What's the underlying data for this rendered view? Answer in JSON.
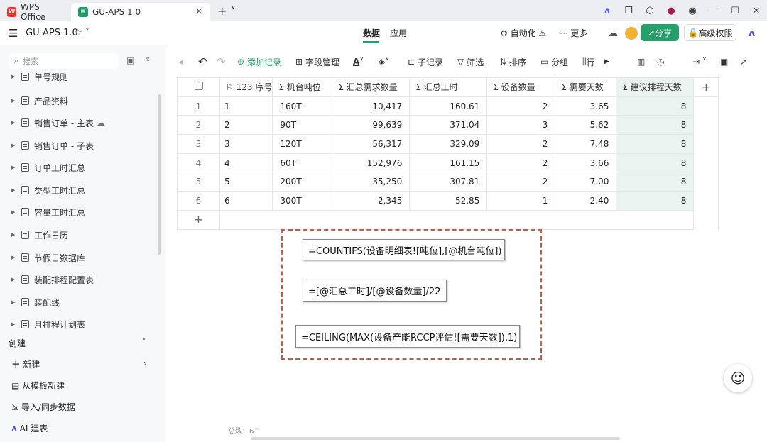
{
  "tabs": [
    {
      "label": "WPS Office"
    },
    {
      "label": "GU-APS 1.0"
    }
  ],
  "app": {
    "title": "GU-APS 1.0",
    "nav": [
      "数据",
      "应用"
    ],
    "automation": "自动化",
    "more": "更多",
    "share": "分享",
    "advanced": "高级权限"
  },
  "sidebar": {
    "search_placeholder": "搜索",
    "items": [
      "单号规则",
      "产品资料",
      "销售订单 - 主表",
      "销售订单 - 子表",
      "订单工时汇总",
      "类型工时汇总",
      "容量工时汇总",
      "工作日历",
      "节假日数据库",
      "装配排程配置表",
      "装配线",
      "月排程计划表"
    ],
    "create_label": "创建",
    "actions": [
      "新建",
      "从模板新建",
      "导入/同步数据",
      "AI 建表"
    ]
  },
  "toolbar": {
    "add_record": "添加记录",
    "field_manage": "字段管理",
    "sub_record": "子记录",
    "filter": "筛选",
    "sort": "排序",
    "group": "分组",
    "row_height": "行"
  },
  "table": {
    "headers": [
      "123 序号",
      "Σ 机台吨位",
      "Σ 汇总需求数量",
      "Σ 汇总工时",
      "Σ 设备数量",
      "Σ 需要天数",
      "Σ 建议排程天数"
    ],
    "rows": [
      [
        "1",
        "1",
        "160T",
        "10,417",
        "160.61",
        "2",
        "3.65",
        "8"
      ],
      [
        "2",
        "2",
        "90T",
        "99,639",
        "371.04",
        "3",
        "5.62",
        "8"
      ],
      [
        "3",
        "3",
        "120T",
        "56,317",
        "329.09",
        "2",
        "7.48",
        "8"
      ],
      [
        "4",
        "4",
        "60T",
        "152,976",
        "161.15",
        "2",
        "3.66",
        "8"
      ],
      [
        "5",
        "5",
        "200T",
        "35,250",
        "307.81",
        "2",
        "7.00",
        "8"
      ],
      [
        "6",
        "6",
        "300T",
        "2,345",
        "52.85",
        "1",
        "2.40",
        "8"
      ]
    ],
    "total": "总数：6"
  },
  "formulas": [
    "=COUNTIFS(设备明细表![吨位],[@机台吨位])",
    "=[@汇总工时]/[@设备数量]/22",
    "=CEILING(MAX(设备产能RCCP评估![需要天数]),1)"
  ],
  "colors": {
    "accent": "#26a06b",
    "wps_red": "#e0382f",
    "highlight": "#eaf3ef",
    "dash": "#c75a40"
  }
}
